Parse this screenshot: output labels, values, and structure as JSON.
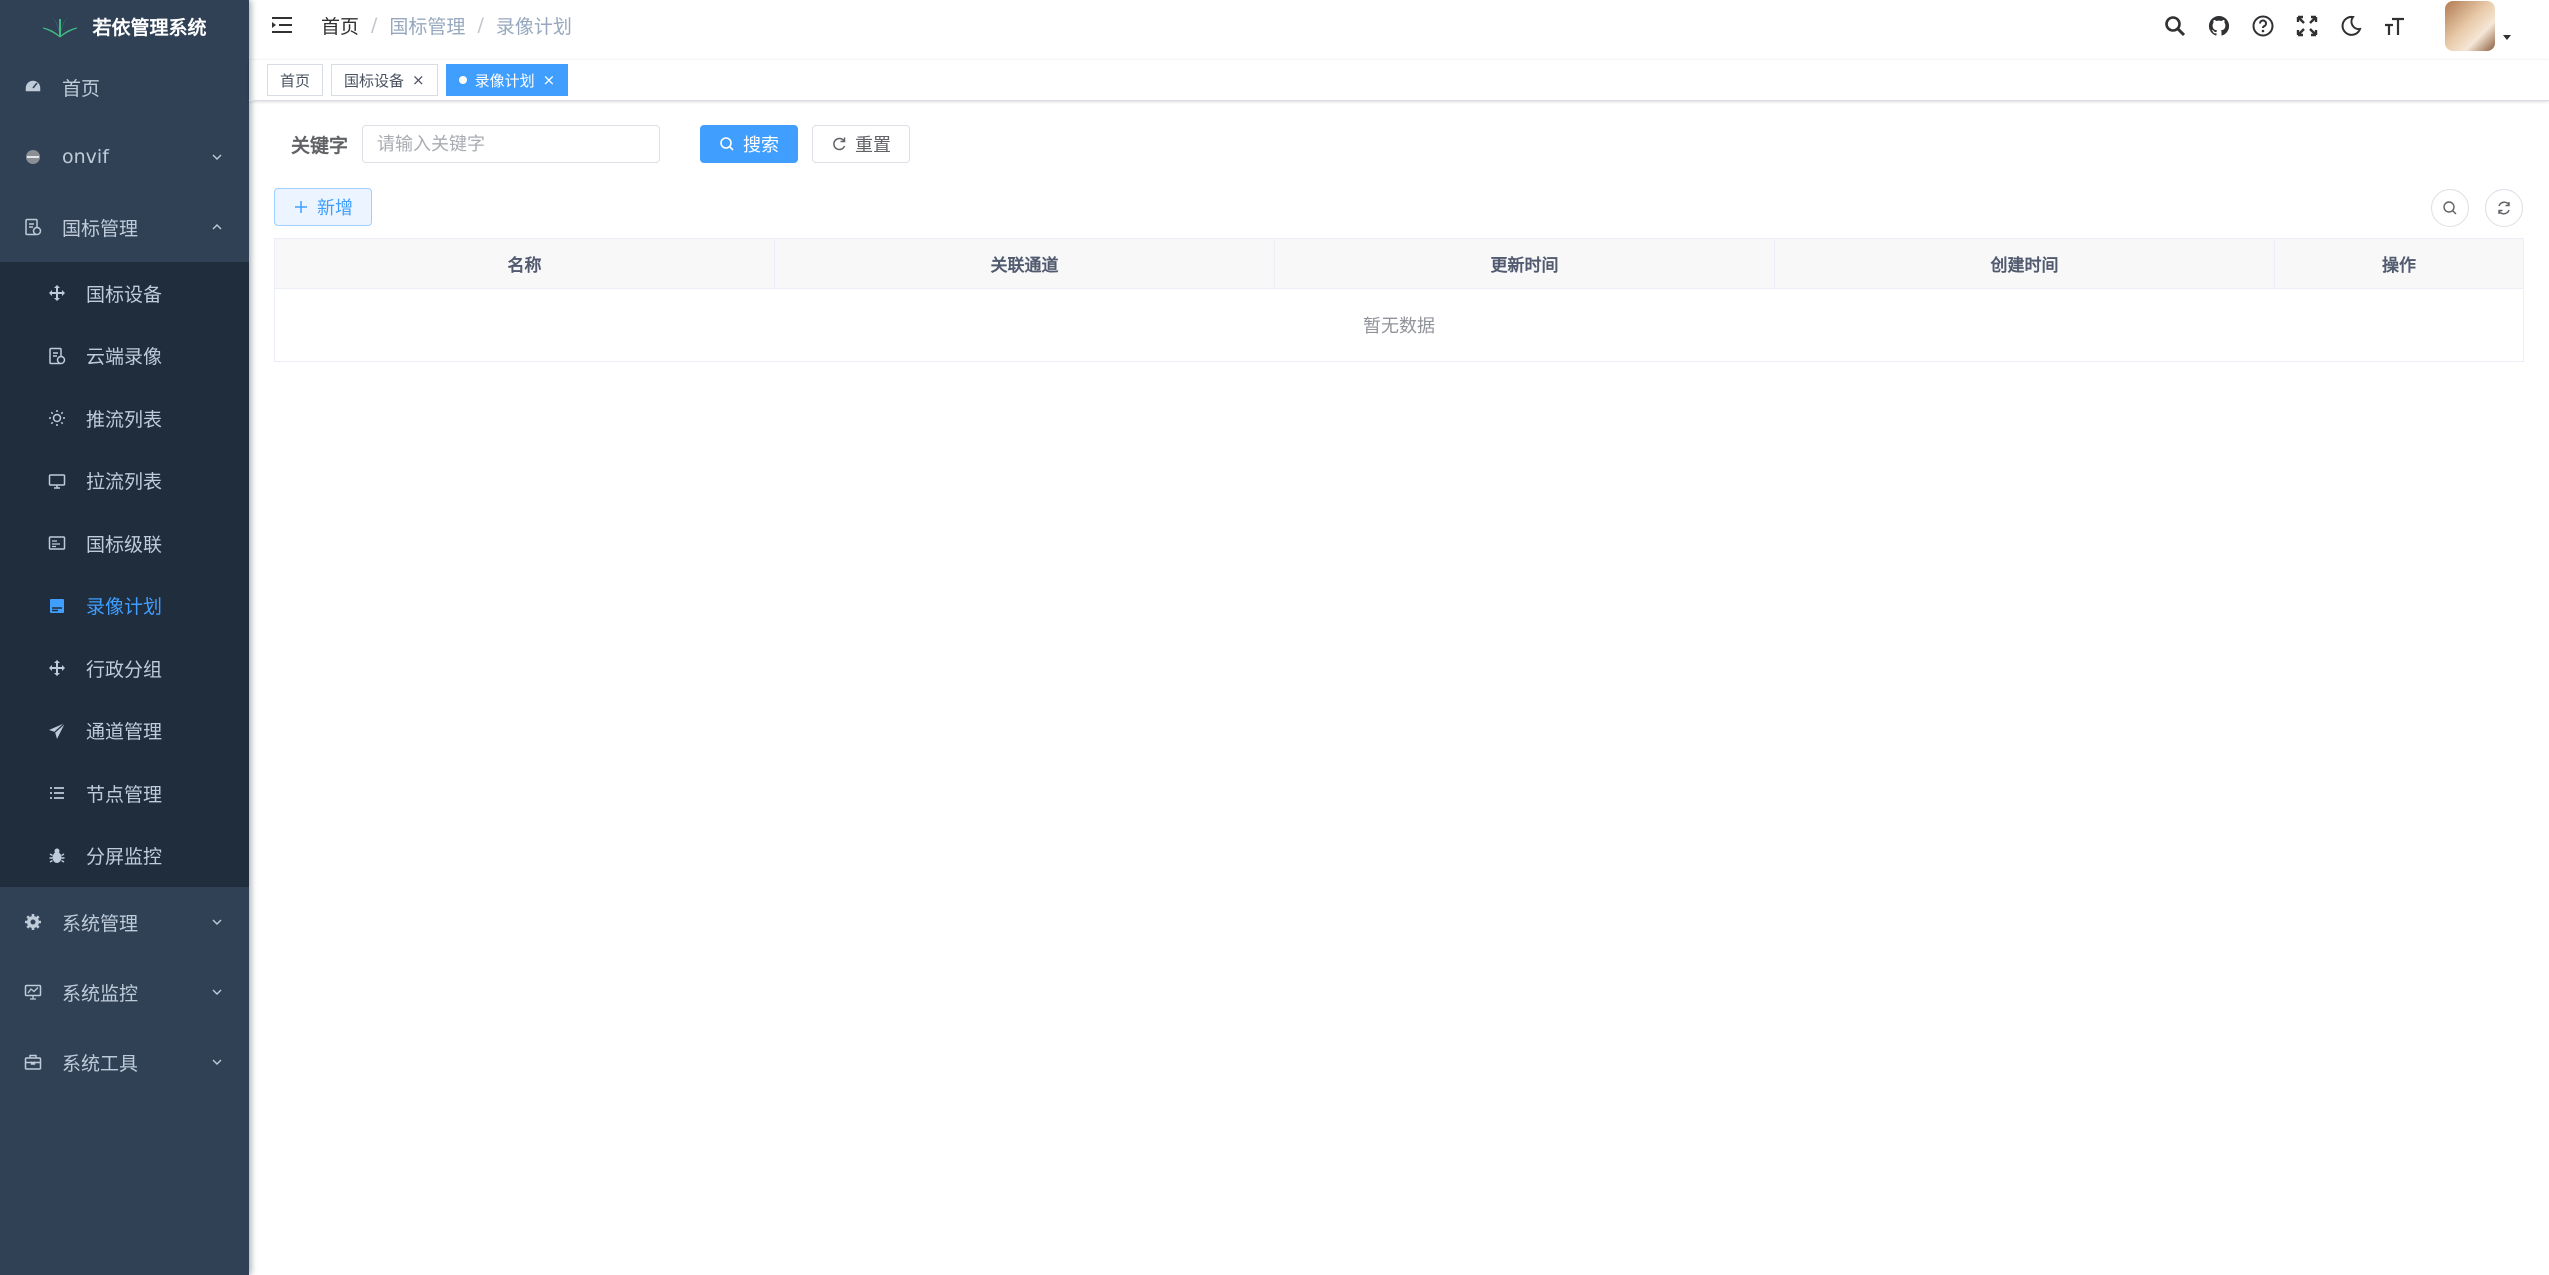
{
  "app": {
    "title": "若依管理系统"
  },
  "sidebar": {
    "items": [
      {
        "label": "首页",
        "icon": "dashboard-icon",
        "expandable": false
      },
      {
        "label": "onvif",
        "icon": "onvif-icon",
        "expandable": true,
        "expanded": false
      },
      {
        "label": "国标管理",
        "icon": "document-icon",
        "expandable": true,
        "expanded": true
      },
      {
        "label": "系统管理",
        "icon": "gear-icon",
        "expandable": true,
        "expanded": false
      },
      {
        "label": "系统监控",
        "icon": "monitor-icon",
        "expandable": true,
        "expanded": false
      },
      {
        "label": "系统工具",
        "icon": "toolbox-icon",
        "expandable": true,
        "expanded": false
      }
    ],
    "submenu": [
      {
        "label": "国标设备",
        "icon": "move-icon"
      },
      {
        "label": "云端录像",
        "icon": "document-icon"
      },
      {
        "label": "推流列表",
        "icon": "sun-icon"
      },
      {
        "label": "拉流列表",
        "icon": "screen-icon"
      },
      {
        "label": "国标级联",
        "icon": "card-icon"
      },
      {
        "label": "录像计划",
        "icon": "calendar-icon",
        "active": true
      },
      {
        "label": "行政分组",
        "icon": "move-icon"
      },
      {
        "label": "通道管理",
        "icon": "send-icon"
      },
      {
        "label": "节点管理",
        "icon": "list-icon"
      },
      {
        "label": "分屏监控",
        "icon": "bug-icon"
      }
    ]
  },
  "navbar": {
    "breadcrumb": [
      "首页",
      "国标管理",
      "录像计划"
    ],
    "icons": [
      "search-icon",
      "github-icon",
      "question-icon",
      "fullscreen-icon",
      "moon-icon",
      "font-size-icon"
    ]
  },
  "tags": [
    {
      "label": "首页",
      "closable": false,
      "active": false
    },
    {
      "label": "国标设备",
      "closable": true,
      "active": false
    },
    {
      "label": "录像计划",
      "closable": true,
      "active": true
    }
  ],
  "search": {
    "label": "关键字",
    "placeholder": "请输入关键字",
    "value": "",
    "search_button": "搜索",
    "reset_button": "重置"
  },
  "toolbar": {
    "add_button": "新增"
  },
  "table": {
    "columns": [
      "名称",
      "关联通道",
      "更新时间",
      "创建时间",
      "操作"
    ],
    "rows": [],
    "empty_text": "暂无数据"
  },
  "colors": {
    "sidebar_bg": "#304156",
    "submenu_bg": "#1f2d3d",
    "primary": "#409eff",
    "text_muted": "#97a8be"
  }
}
